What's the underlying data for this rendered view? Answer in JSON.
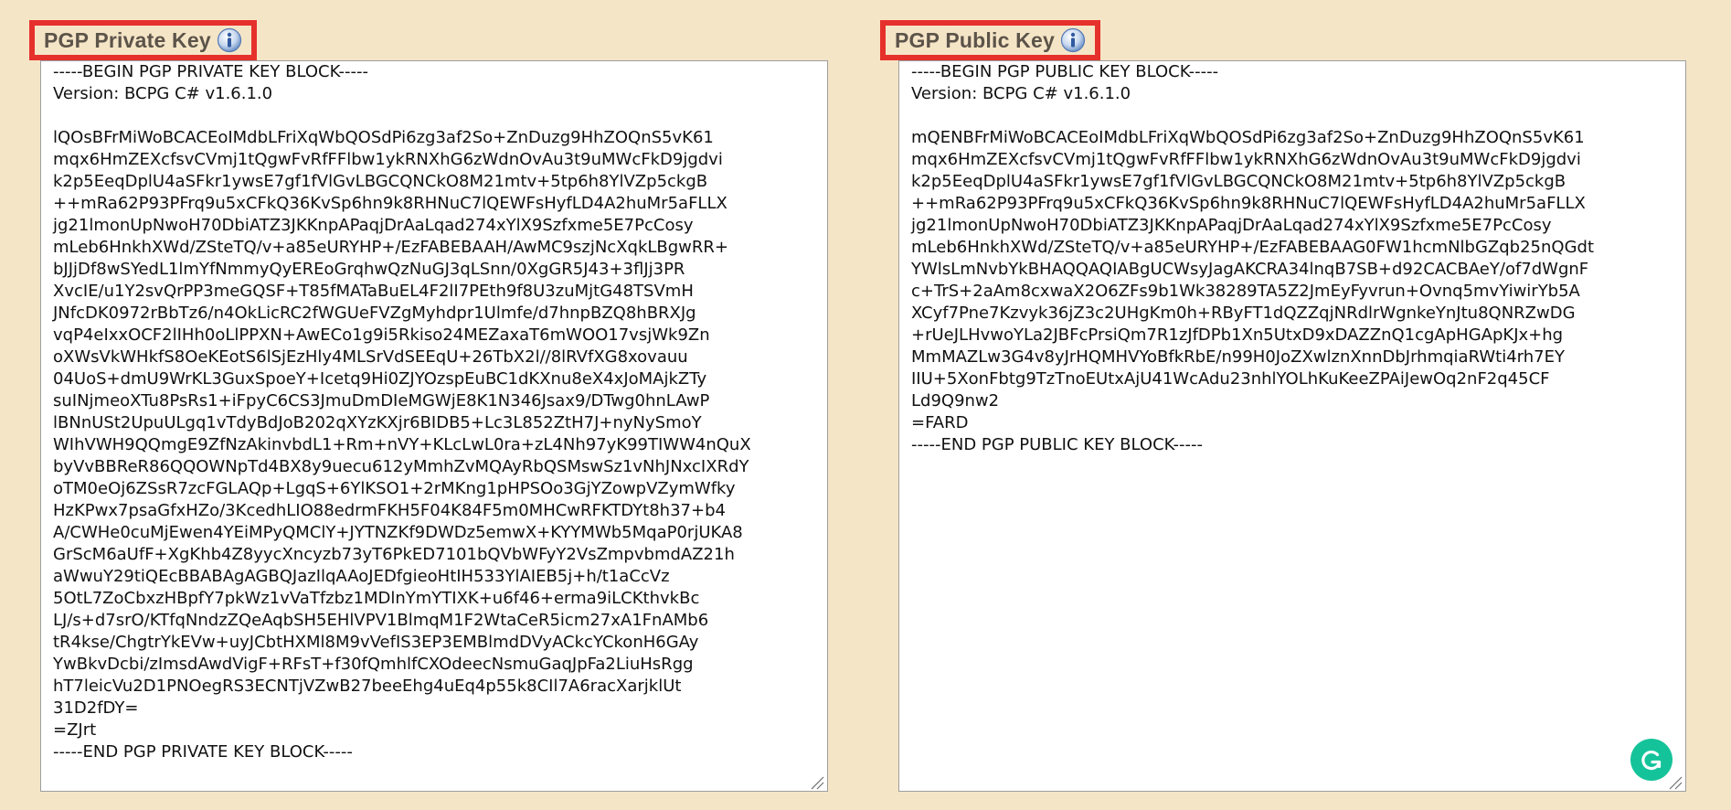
{
  "private_key": {
    "label": "PGP Private Key",
    "icon": "info-icon",
    "text": "-----BEGIN PGP PRIVATE KEY BLOCK-----\nVersion: BCPG C# v1.6.1.0\n\nlQOsBFrMiWoBCACEoIMdbLFriXqWbQOSdPi6zg3af2So+ZnDuzg9HhZOQnS5vK61\nmqx6HmZEXcfsvCVmj1tQgwFvRfFFlbw1ykRNXhG6zWdnOvAu3t9uMWcFkD9jgdvi\nk2p5EeqDplU4aSFkr1ywsE7gf1fVlGvLBGCQNCkO8M21mtv+5tp6h8YlVZp5ckgB\n++mRa62P93PFrq9u5xCFkQ36KvSp6hn9k8RHNuC7lQEWFsHyfLD4A2huMr5aFLLX\njg21lmonUpNwoH70DbiATZ3JKKnpAPaqjDrAaLqad274xYlX9Szfxme5E7PcCosy\nmLeb6HnkhXWd/ZSteTQ/v+a85eURYHP+/EzFABEBAAH/AwMC9szjNcXqkLBgwRR+\nbJJjDf8wSYedL1lmYfNmmyQyEREoGrqhwQzNuGJ3qLSnn/0XgGR5J43+3flJj3PR\nXvcIE/u1Y2svQrPP3meGQSF+T85fMATaBuEL4F2lI7PEth9f8U3zuMjtG48TSVmH\nJNfcDK0972rBbTz6/n4OkLicRC2fWGUeFVZgMyhdpr1Ulmfe/d7hnpBZQ8hBRXJg\nvqP4eIxxOCF2lIHh0oLlPPXN+AwECo1g9i5Rkiso24MEZaxaT6mWOO17vsjWk9Zn\noXWsVkWHkfS8OeKEotS6lSjEzHly4MLSrVdSEEqU+26TbX2l//8lRVfXG8xovauu\n04UoS+dmU9WrKL3GuxSpoeY+Icetq9Hi0ZJYOzspEuBC1dKXnu8eX4xJoMAjkZTy\nsuINjmeoXTu8PsRs1+iFpyC6CS3JmuDmDIeMGWjE8K1N346Jsax9/DTwg0hnLAwP\nlBNnUSt2UpuULgq1vTdyBdJoB202qXYzKXjr6BIDB5+Lc3L852ZtH7J+nyNySmoY\nWIhVWH9QQmgE9ZfNzAkinvbdL1+Rm+nVY+KLcLwL0ra+zL4Nh97yK99TIWW4nQuX\nbyVvBBReR86QQOWNpTd4BX8y9uecu612yMmhZvMQAyRbQSMswSz1vNhJNxcIXRdY\noTM0eOj6ZSsR7zcFGLAQp+LgqS+6YlKSO1+2rMKng1pHPSOo3GjYZowpVZymWfky\nHzKPwx7psaGfxHZo/3KcedhLIO88edrmFKH5F04K84F5m0MHCwRFKTDYt8h37+b4\nA/CWHe0cuMjEwen4YEiMPyQMClY+JYTNZKf9DWDz5emwX+KYYMWb5MqaP0rjUKA8\nGrScM6aUfF+XgKhb4Z8yycXncyzb73yT6PkED7101bQVbWFyY2VsZmpvbmdAZ21h\naWwuY29tiQEcBBABAgAGBQJazIlqAAoJEDfgieoHtIH533YlAIEB5j+h/t1aCcVz\n5OtL7ZoCbxzHBpfY7pkWz1vVaTfzbz1MDlnYmYTIXK+u6f46+erma9iLCKthvkBc\nLJ/s+d7srO/KTfqNndzZQeAqbSH5EHlVPV1BlmqM1F2WtaCeR5icm27xA1FnAMb6\ntR4kse/ChgtrYkEVw+uyJCbtHXMl8M9vVefIS3EP3EMBlmdDVyACkcYCkonH6GAy\nYwBkvDcbi/zImsdAwdVigF+RFsT+f30fQmhlfCXOdeecNsmuGaqJpFa2LiuHsRgg\nhT7leicVu2D1PNOegRS3ECNTjVZwB27beeEhg4uEq4p55k8CIl7A6racXarjklUt\n31D2fDY=\n=ZJrt\n-----END PGP PRIVATE KEY BLOCK-----"
  },
  "public_key": {
    "label": "PGP Public Key",
    "icon": "info-icon",
    "text": "-----BEGIN PGP PUBLIC KEY BLOCK-----\nVersion: BCPG C# v1.6.1.0\n\nmQENBFrMiWoBCACEoIMdbLFriXqWbQOSdPi6zg3af2So+ZnDuzg9HhZOQnS5vK61\nmqx6HmZEXcfsvCVmj1tQgwFvRfFFlbw1ykRNXhG6zWdnOvAu3t9uMWcFkD9jgdvi\nk2p5EeqDplU4aSFkr1ywsE7gf1fVlGvLBGCQNCkO8M21mtv+5tp6h8YlVZp5ckgB\n++mRa62P93PFrq9u5xCFkQ36KvSp6hn9k8RHNuC7lQEWFsHyfLD4A2huMr5aFLLX\njg21lmonUpNwoH70DbiATZ3JKKnpAPaqjDrAaLqad274xYlX9Szfxme5E7PcCosy\nmLeb6HnkhXWd/ZSteTQ/v+a85eURYHP+/EzFABEBAAG0FW1hcmNlbGZqb25nQGdt\nYWlsLmNvbYkBHAQQAQIABgUCWsyJagAKCRA34lnqB7SB+d92CACBAeY/of7dWgnF\nc+TrS+2aAm8cxwaX2O6ZFs9b1Wk38289TA5Z2JmEyFyvrun+Ovnq5mvYiwirYb5A\nXCyf7Pne7Kzvyk36jZ3c2UHgKm0h+RByFT1dQZZqjNRdlrWgnkeYnJtu8QNRZwDG\n+rUeJLHvwoYLa2JBFcPrsiQm7R1zJfDPb1Xn5UtxD9xDAZZnQ1cgApHGApKJx+hg\nMmMAZLw3G4v8yJrHQMHVYoBfkRbE/n99H0JoZXwlznXnnDbJrhmqiaRWti4rh7EY\nIIU+5XonFbtg9TzTnoEUtxAjU41WcAdu23nhlYOLhKuKeeZPAiJewOq2nF2q45CF\nLd9Q9nw2\n=FARD\n-----END PGP PUBLIC KEY BLOCK-----"
  },
  "colors": {
    "background": "#f5e5c7",
    "highlight_border": "#e6302b",
    "grammarly": "#15c39a"
  },
  "grammarly": {
    "icon": "grammarly-icon"
  }
}
